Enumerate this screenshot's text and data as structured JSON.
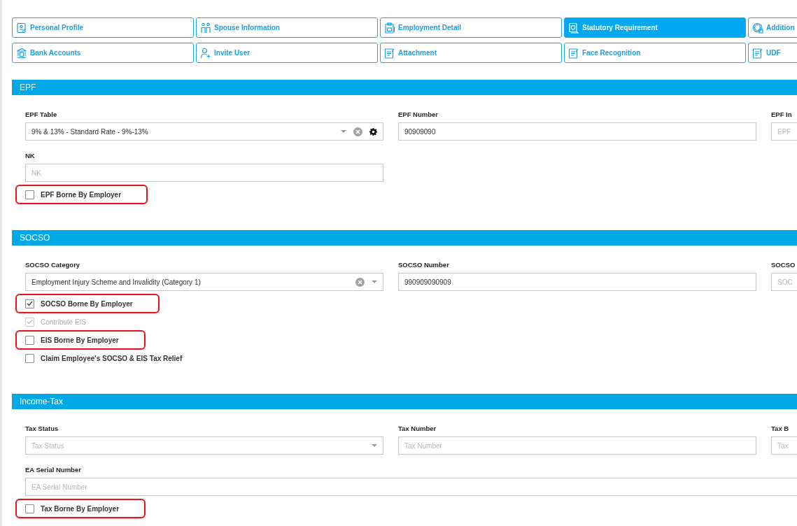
{
  "tabs": [
    {
      "label": "Personal Profile",
      "selected": false
    },
    {
      "label": "Spouse Information",
      "selected": false
    },
    {
      "label": "Employment Detail",
      "selected": false
    },
    {
      "label": "Statutory Requirement",
      "selected": true
    },
    {
      "label": "Addition",
      "selected": false
    },
    {
      "label": "Bank Accounts",
      "selected": false
    },
    {
      "label": "Invite User",
      "selected": false
    },
    {
      "label": "Attachment",
      "selected": false
    },
    {
      "label": "Face Recognition",
      "selected": false
    },
    {
      "label": "UDF",
      "selected": false
    }
  ],
  "sections": [
    {
      "title": "EPF",
      "rows": [
        [
          {
            "kind": "select",
            "label": "EPF Table",
            "value": "9% & 13% - Standard Rate - 9%-13%",
            "clearable": true,
            "settings": true
          },
          {
            "kind": "text",
            "label": "EPF Number",
            "value": "90909090"
          },
          {
            "kind": "text",
            "label": "EPF In",
            "placeholder": "EPF"
          }
        ],
        [
          {
            "kind": "text",
            "label": "NK",
            "placeholder": "NK"
          }
        ]
      ],
      "checkboxes": [
        {
          "label": "EPF Borne By Employer",
          "checked": false,
          "disabled": false,
          "highlighted": true
        }
      ]
    },
    {
      "title": "SOCSO",
      "rows": [
        [
          {
            "kind": "select",
            "label": "SOCSO Category",
            "value": "Employment Injury Scheme and Invalidity (Category 1)",
            "clearable": true,
            "settings": false
          },
          {
            "kind": "text",
            "label": "SOCSO Number",
            "value": "990909090909"
          },
          {
            "kind": "text",
            "label": "SOCSO",
            "placeholder": "SOC"
          }
        ]
      ],
      "checkboxes": [
        {
          "label": "SOCSO Borne By Employer",
          "checked": true,
          "disabled": false,
          "highlighted": true
        },
        {
          "label": "Contribute EIS",
          "checked": true,
          "disabled": true,
          "highlighted": false
        },
        {
          "label": "EIS Borne By Employer",
          "checked": false,
          "disabled": false,
          "highlighted": true
        },
        {
          "label": "Claim Employee's SOCSO & EIS Tax Relief",
          "checked": false,
          "disabled": false,
          "highlighted": false
        }
      ]
    },
    {
      "title": "Income-Tax",
      "rows": [
        [
          {
            "kind": "select",
            "label": "Tax Status",
            "placeholder": "Tax Status",
            "clearable": false,
            "settings": false
          },
          {
            "kind": "text",
            "label": "Tax Number",
            "placeholder": "Tax Number"
          },
          {
            "kind": "text",
            "label": "Tax B",
            "placeholder": "Tax"
          }
        ],
        [
          {
            "kind": "text",
            "label": "EA Serial Number",
            "placeholder": "EA Serial Number",
            "wide": true
          }
        ]
      ],
      "checkboxes": [
        {
          "label": "Tax Borne By Employer",
          "checked": false,
          "disabled": false,
          "highlighted": true
        }
      ]
    }
  ]
}
